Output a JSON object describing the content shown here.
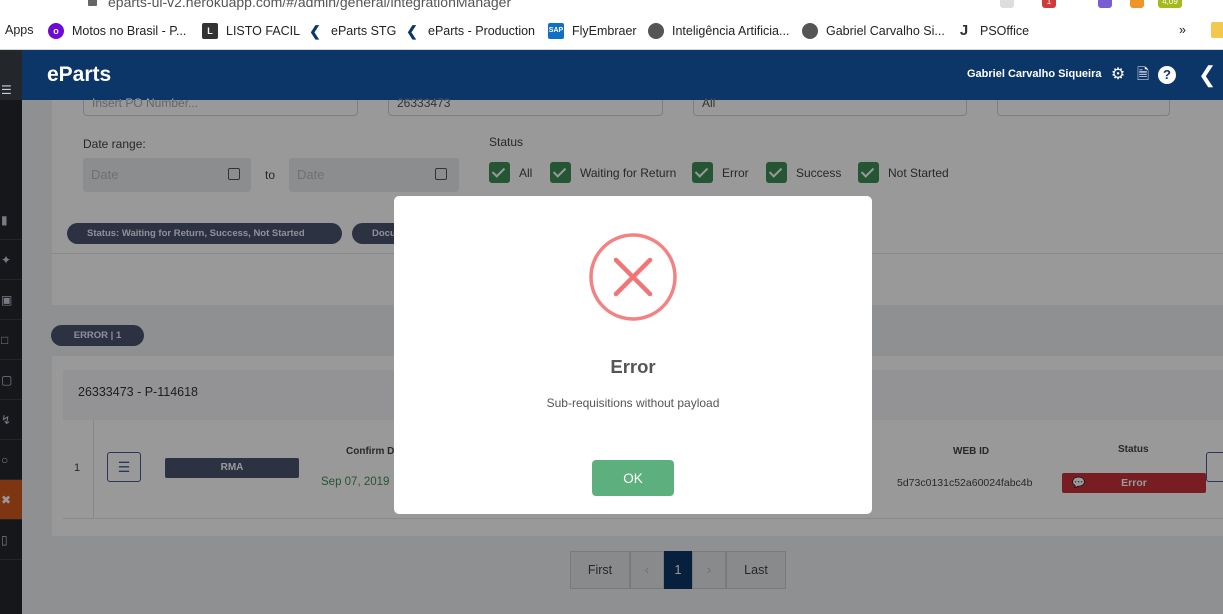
{
  "browser": {
    "url": "eparts-ui-v2.herokuapp.com/#/admin/general/integrationManager",
    "ext_badge": "1",
    "ext_counter": "4,09",
    "bookmarks_more": "»",
    "bookmarks": [
      {
        "label": "Apps",
        "icon": "apps-grid-icon"
      },
      {
        "label": "Motos no Brasil - P...",
        "icon": "olx-icon"
      },
      {
        "label": "LISTO FACIL",
        "icon": "listo-icon"
      },
      {
        "label": "eParts STG",
        "icon": "eparts-arrow-icon"
      },
      {
        "label": "eParts - Production",
        "icon": "eparts-arrow-icon"
      },
      {
        "label": "FlyEmbraer",
        "icon": "sap-icon"
      },
      {
        "label": "Inteligência Artificia...",
        "icon": "globe-icon"
      },
      {
        "label": "Gabriel Carvalho Si...",
        "icon": "globe-icon"
      },
      {
        "label": "PSOffice",
        "icon": "psoffice-icon"
      }
    ]
  },
  "header": {
    "logo": "eParts",
    "user": "Gabriel Carvalho Siqueira"
  },
  "filters": {
    "po_placeholder": "Insert PO Number...",
    "po_value": "26333473",
    "select_value": "All",
    "date_label": "Date range:",
    "date_from_placeholder": "Date",
    "date_to_label": "to",
    "date_to_placeholder": "Date",
    "status_label": "Status",
    "status_options": [
      "All",
      "Waiting for Return",
      "Error",
      "Success",
      "Not Started"
    ]
  },
  "chips": {
    "status": "Status: Waiting for Return, Success, Not Started",
    "document": "Docu"
  },
  "results": {
    "group_label": "ERROR | 1",
    "heading": "26333473 - P-114618",
    "columns": {
      "confirm": "Confirm D",
      "web_id": "WEB ID",
      "status": "Status"
    },
    "row": {
      "index": "1",
      "type": "RMA",
      "date": "Sep 07, 2019",
      "web_id": "5d73c0131c52a60024fabc4b",
      "status": "Error"
    }
  },
  "pagination": {
    "first": "First",
    "prev": "‹",
    "current": "1",
    "next": "›",
    "last": "Last"
  },
  "modal": {
    "title": "Error",
    "message": "Sub-requisitions without payload",
    "ok_label": "OK",
    "icon": "error-x-icon",
    "accent": "#f27474"
  },
  "colors": {
    "header": "#0c3668",
    "sidebar": "#23272c",
    "sidebar_active": "#d25a1e",
    "check": "#3e8f55",
    "ok_button": "#5daf7d",
    "error_badge": "#c8333a"
  }
}
